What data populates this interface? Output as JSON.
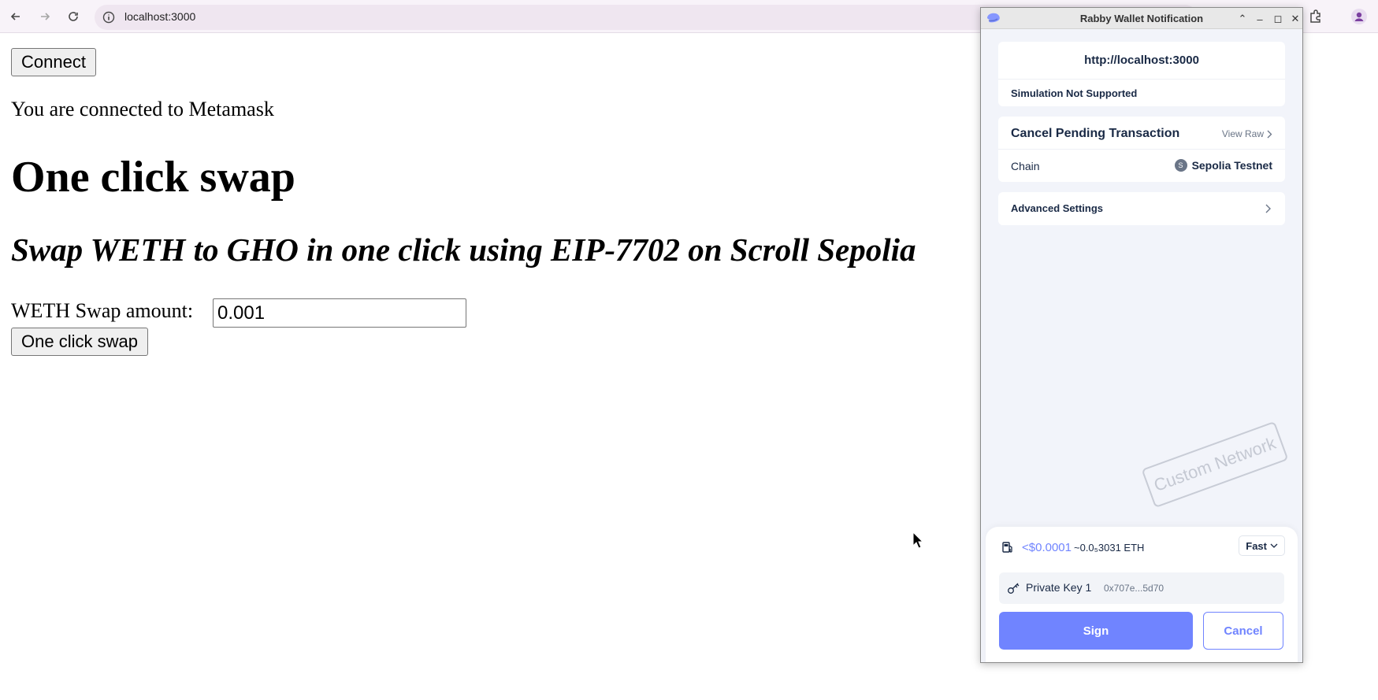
{
  "browser": {
    "url": "localhost:3000",
    "icons": [
      "back-icon",
      "forward-icon",
      "reload-icon",
      "site-info-icon",
      "extensions-icon",
      "profile-icon"
    ]
  },
  "page": {
    "connect_label": "Connect",
    "status_text": "You are connected to Metamask",
    "heading": "One click swap",
    "subheading": "Swap WETH to GHO in one click using EIP-7702 on Scroll Sepolia",
    "amount_label": "WETH Swap amount:",
    "amount_value": "0.001",
    "swap_label": "One click swap"
  },
  "wallet": {
    "window_title": "Rabby Wallet Notification",
    "origin": "http://localhost:3000",
    "simulation_status": "Simulation Not Supported",
    "tx_title": "Cancel Pending Transaction",
    "view_raw_label": "View Raw",
    "chain_label": "Chain",
    "chain_badge": "S",
    "chain_value": "Sepolia Testnet",
    "advanced_label": "Advanced Settings",
    "watermark": "Custom Network",
    "gas_usd": "<$0.0001",
    "gas_eth": "~0.0₅3031 ETH",
    "gas_speed": "Fast",
    "key_name": "Private Key 1",
    "key_address": "0x707e...5d70",
    "sign_label": "Sign",
    "cancel_label": "Cancel",
    "accent_color": "#7084ff"
  }
}
